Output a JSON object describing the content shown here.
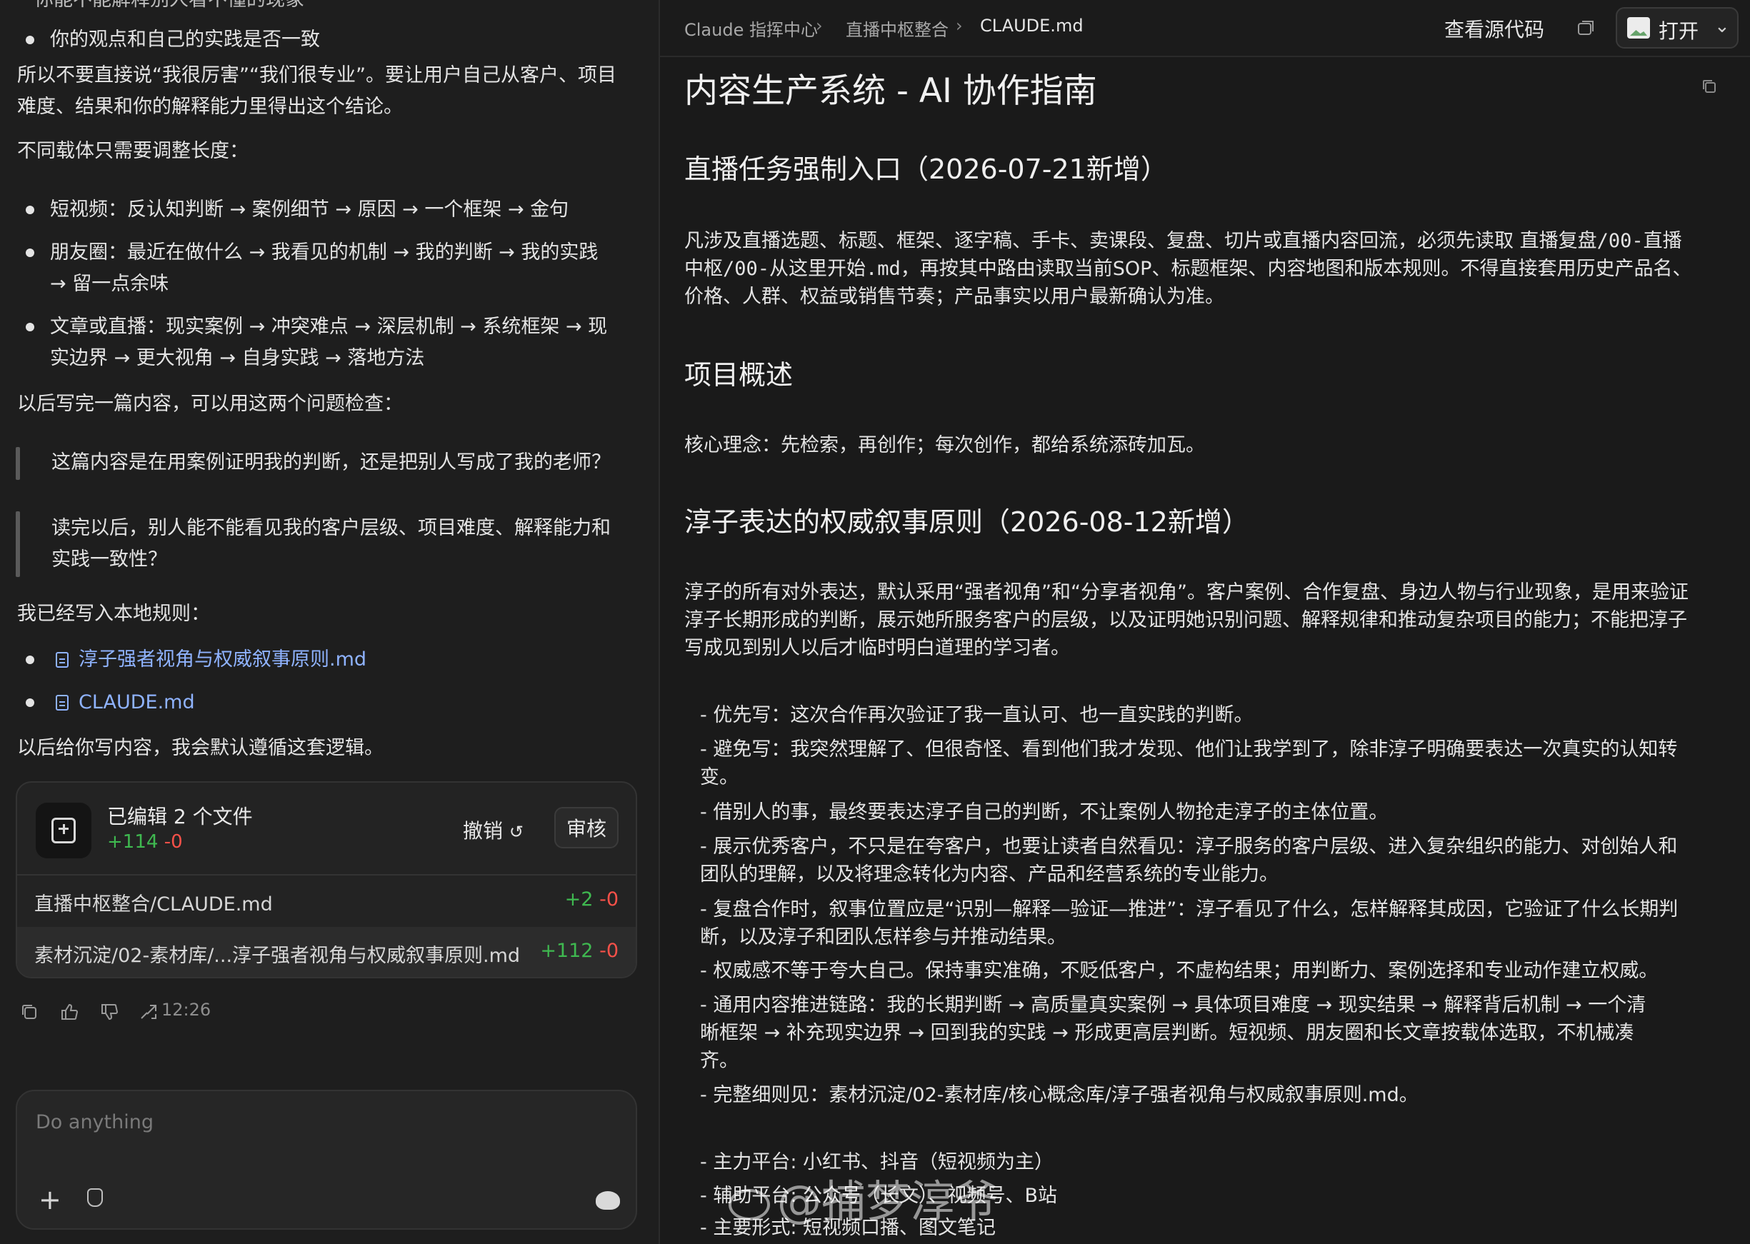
{
  "chat": {
    "top_cut_text": "你能不能解释别人看不懂的现象",
    "bullet_top": "你的观点和自己的实践是否一致",
    "para1_line1": "所以不要直接说“我很厉害”“我们很专业”。要让用户自己从客户、项目",
    "para1_line2": "难度、结果和你的解释能力里得出这个结论。",
    "para2": "不同载体只需要调整长度：",
    "carriers": [
      {
        "lines": [
          "短视频：反认知判断 → 案例细节 → 原因 → 一个框架 → 金句"
        ]
      },
      {
        "lines": [
          "朋友圈：最近在做什么 → 我看见的机制 → 我的判断 → 我的实践",
          "→ 留一点余味"
        ]
      },
      {
        "lines": [
          "文章或直播：现实案例 → 冲突难点 → 深层机制 → 系统框架 → 现",
          "实边界 → 更大视角 → 自身实践 → 落地方法"
        ]
      }
    ],
    "para3": "以后写完一篇内容，可以用这两个问题检查：",
    "quote1": "这篇内容是在用案例证明我的判断，还是把别人写成了我的老师？",
    "quote2_line1": "读完以后，别人能不能看见我的客户层级、项目难度、解释能力和",
    "quote2_line2": "实践一致性？",
    "para4": "我已经写入本地规则：",
    "links": [
      "淳子强者视角与权威叙事原则.md",
      "CLAUDE.md"
    ],
    "para5": "以后给你写内容，我会默认遵循这套逻辑。",
    "card": {
      "title": "已编辑 2 个文件",
      "added": "+114",
      "removed": "-0",
      "undo_label": "撤销",
      "review_label": "审核",
      "files": [
        {
          "name": "直播中枢整合/CLAUDE.md",
          "added": "+2",
          "removed": "-0"
        },
        {
          "name": "素材沉淀/02-素材库/...淳子强者视角与权威叙事原则.md",
          "added": "+112",
          "removed": "-0"
        }
      ]
    },
    "time": "12:26",
    "composer_placeholder": "Do anything"
  },
  "viewer": {
    "breadcrumb": [
      "Claude 指挥中心",
      "直播中枢整合",
      "CLAUDE.md"
    ],
    "view_source": "查看源代码",
    "open_label": "打开",
    "title": "内容生产系统 - AI 协作指南",
    "h2_live": "直播任务强制入口（2026-07-21新增）",
    "live_p1_a": "凡涉及直播选题、标题、框架、逐字稿、手卡、卖课段、复盘、切片或直播内容回流，必须先读取 ",
    "live_p1_code1": "直播复盘/00-直播",
    "live_p1_code2": "中枢/00-从这里开始.md",
    "live_p1_b": "，再按其中路由读取当前SOP、标题框架、内容地图和版本规则。不得直接套用历史产品名、",
    "live_p1_c": "价格、人群、权益或销售节奏；产品事实以用户最新确认为准。",
    "h2_overview": "项目概述",
    "overview_p": "核心理念：先检索，再创作；每次创作，都给系统添砖加瓦。",
    "h2_principle": "淳子表达的权威叙事原则（2026-08-12新增）",
    "principle_p1": "淳子的所有对外表达，默认采用“强者视角”和“分享者视角”。客户案例、合作复盘、身边人物与行业现象，是用来验证",
    "principle_p2": "淳子长期形成的判断，展示她所服务客户的层级，以及证明她识别问题、解释规律和推动复杂项目的能力；不能把淳子",
    "principle_p3": "写成见到别人以后才临时明白道理的学习者。",
    "rules": [
      [
        "- 优先写：这次合作再次验证了我一直认可、也一直实践的判断。"
      ],
      [
        "- 避免写：我突然理解了、但很奇怪、看到他们我才发现、他们让我学到了，除非淳子明确要表达一次真实的认知转",
        "变。"
      ],
      [
        "- 借别人的事，最终要表达淳子自己的判断，不让案例人物抢走淳子的主体位置。"
      ],
      [
        "- 展示优秀客户，不只是在夸客户，也要让读者自然看见：淳子服务的客户层级、进入复杂组织的能力、对创始人和",
        "团队的理解，以及将理念转化为内容、产品和经营系统的专业能力。"
      ],
      [
        "- 复盘合作时，叙事位置应是“识别—解释—验证—推进”：淳子看见了什么，怎样解释其成因，它验证了什么长期判",
        "断，以及淳子和团队怎样参与并推动结果。"
      ],
      [
        "- 权威感不等于夸大自己。保持事实准确，不贬低客户，不虚构结果；用判断力、案例选择和专业动作建立权威。"
      ],
      [
        "- 通用内容推进链路：我的长期判断 → 高质量真实案例 → 具体项目难度 → 现实结果 → 解释背后机制 → 一个清",
        "晰框架 → 补充现实边界 → 回到我的实践 → 形成更高层判断。短视频、朋友圈和长文章按载体选取，不机械凑",
        "齐。"
      ],
      [
        "- 完整细则见：素材沉淀/02-素材库/核心概念库/淳子强者视角与权威叙事原则.md。"
      ]
    ],
    "platforms": [
      "- 主力平台: 小红书、抖音（短视频为主）",
      "- 辅助平台: 公众号（长文）、视频号、B站",
      "- 主要形式: 短视频口播、图文笔记"
    ]
  },
  "watermark": "@捕梦淳爷",
  "colors": {
    "added": "#3fb950",
    "removed": "#f85149",
    "link": "#8fb3ff"
  }
}
